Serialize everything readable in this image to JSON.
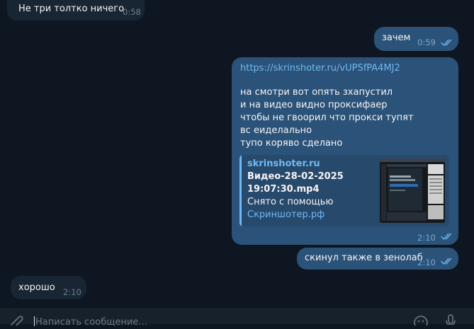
{
  "messages": [
    {
      "direction": "incoming",
      "text": "Не три толтко ничего",
      "time": "0:58"
    },
    {
      "direction": "outgoing",
      "text": "зачем",
      "time": "0:59"
    },
    {
      "direction": "outgoing",
      "link": "https://skrinshoter.ru/vUPSfPA4MJ2",
      "lines": [
        "на смотри вот опять зхапустил",
        "и на видео видно проксифаер",
        "чтобы не гвоорил что прокси тупят",
        "вс еиделально",
        "тупо коряво сделано"
      ],
      "preview": {
        "site": "skrinshoter.ru",
        "title_lines": [
          "Видео-28-02-2025",
          "19:07:30.mp4"
        ],
        "desc_line": "Снято с помощью",
        "desc_link": "Скриншотер.рф"
      },
      "time": "2:10"
    },
    {
      "direction": "outgoing",
      "text": "скинул также в зенолаб",
      "time": "2:10"
    },
    {
      "direction": "incoming",
      "text": "хорошо",
      "time": "2:10"
    }
  ],
  "composer": {
    "placeholder": "Написать сообщение...",
    "icons": [
      "paperclip-icon",
      "emoji-icon",
      "microphone-icon"
    ]
  },
  "colors": {
    "background": "#0e1621",
    "incoming_bubble": "#182533",
    "outgoing_bubble": "#2b5278",
    "link": "#71b9f3",
    "read_ticks": "#71b9f3"
  }
}
